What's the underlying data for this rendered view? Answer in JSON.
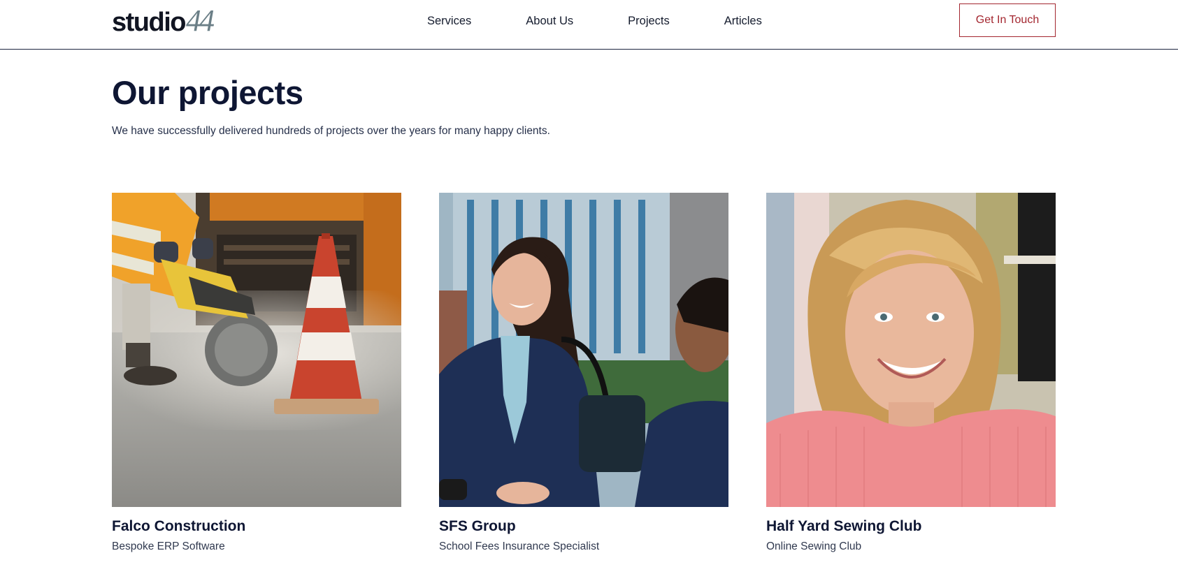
{
  "header": {
    "logo": {
      "word": "studio",
      "number": "44"
    },
    "nav": [
      {
        "label": "Services"
      },
      {
        "label": "About Us"
      },
      {
        "label": "Projects"
      },
      {
        "label": "Articles"
      }
    ],
    "cta_label": "Get In Touch"
  },
  "hero": {
    "title": "Our projects",
    "intro": "We have successfully delivered hundreds of projects over the years for many happy clients."
  },
  "projects": [
    {
      "name": "Falco Construction",
      "description": "Bespoke ERP Software"
    },
    {
      "name": "SFS Group",
      "description": "School Fees Insurance Specialist"
    },
    {
      "name": "Half Yard Sewing Club",
      "description": "Online Sewing Club"
    }
  ],
  "colors": {
    "navy": "#0e1633",
    "accent": "#a3262f",
    "logo_number": "#6b7f87"
  }
}
